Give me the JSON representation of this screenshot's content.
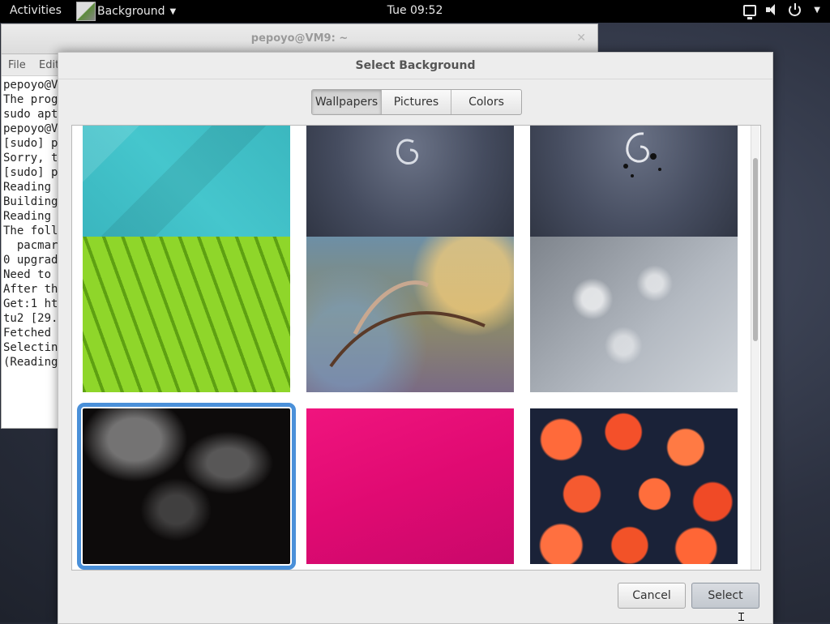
{
  "topbar": {
    "activities": "Activities",
    "app_name": "Background",
    "clock": "Tue 09:52",
    "icons": [
      "network-icon",
      "volume-icon",
      "power-icon"
    ]
  },
  "terminal": {
    "title": "pepoyo@VM9: ~",
    "menu": [
      "File",
      "Edit"
    ],
    "lines": [
      "pepoyo@V",
      "The prog",
      "sudo apt",
      "pepoyo@V",
      "[sudo] p",
      "Sorry, t",
      "[sudo] p",
      "Reading",
      "Building",
      "Reading",
      "The foll",
      "  pacmar",
      "0 upgrad",
      "Need to",
      "After th",
      "Get:1 ht",
      "tu2 [29.",
      "Fetched",
      "Selectin",
      "(Reading"
    ]
  },
  "dialog": {
    "title": "Select Background",
    "tabs": [
      "Wallpapers",
      "Pictures",
      "Colors"
    ],
    "active_tab": "Wallpapers",
    "wallpapers": [
      {
        "name": "Teal geometric",
        "color": "#3fbcc4",
        "current": true
      },
      {
        "name": "Debian swirl",
        "color": "#4c5468"
      },
      {
        "name": "Debian splash",
        "color": "#525a6e"
      },
      {
        "name": "Green leaf",
        "color": "#7ec41c"
      },
      {
        "name": "Grass stalk",
        "color": "#6b7a6a"
      },
      {
        "name": "Dandelion",
        "color": "#9aa0a8"
      },
      {
        "name": "Dark leaves",
        "color": "#151313",
        "selected": true
      },
      {
        "name": "Pink fabric",
        "color": "#e60f78"
      },
      {
        "name": "Orange flowers",
        "color": "#e24a24"
      }
    ],
    "buttons": {
      "cancel": "Cancel",
      "select": "Select"
    },
    "accent_color": "#4a90d9"
  }
}
